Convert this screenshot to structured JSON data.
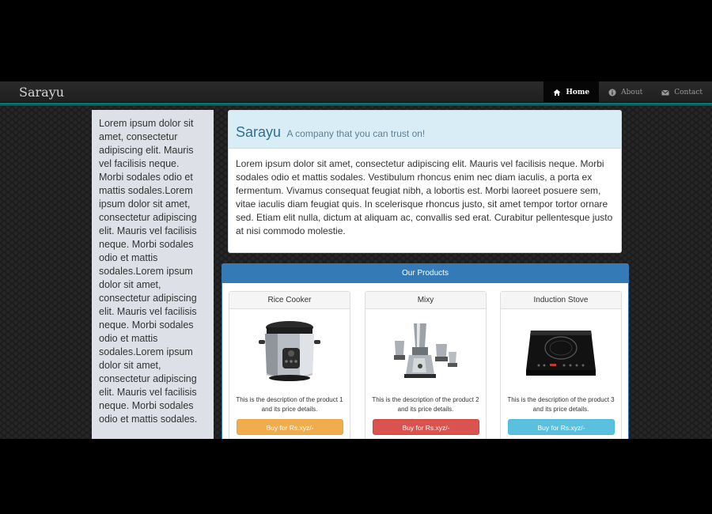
{
  "navbar": {
    "brand": "Sarayu",
    "items": [
      {
        "label": "Home",
        "icon": "home-icon",
        "active": true
      },
      {
        "label": "About",
        "icon": "info-icon",
        "active": false
      },
      {
        "label": "Contact",
        "icon": "envelope-icon",
        "active": false
      }
    ]
  },
  "sidebar": {
    "text": "Lorem ipsum dolor sit amet, consectetur adipiscing elit. Mauris vel facilisis neque. Morbi sodales odio et mattis sodales.Lorem ipsum dolor sit amet, consectetur adipiscing elit. Mauris vel facilisis neque. Morbi sodales odio et mattis sodales.Lorem ipsum dolor sit amet, consectetur adipiscing elit. Mauris vel facilisis neque. Morbi sodales odio et mattis sodales.Lorem ipsum dolor sit amet, consectetur adipiscing elit. Mauris vel facilisis neque. Morbi sodales odio et mattis sodales."
  },
  "hero": {
    "title": "Sarayu",
    "tagline": "A company that you can trust on!",
    "body": "Lorem ipsum dolor sit amet, consectetur adipiscing elit. Mauris vel facilisis neque. Morbi sodales odio et mattis sodales. Vestibulum rhoncus enim nec diam iaculis, a porta ex fermentum. Vivamus consequat feugiat nibh, a lobortis est. Morbi laoreet posuere sem, vitae iaculis diam feugiat quis. In scelerisque rhoncus justo, sit amet tempor tortor ornare sed. Etiam elit nulla, dictum at aliquam ac, convallis sed erat. Curabitur pellentesque justo at nisi commodo molestie."
  },
  "products": {
    "heading": "Our Products",
    "items": [
      {
        "name": "Rice Cooker",
        "description": "This is the description of the product 1 and its price details.",
        "button": "Buy for Rs.xyz/-",
        "button_color": "#f0ad4e",
        "image": "rice-cooker-image"
      },
      {
        "name": "Mixy",
        "description": "This is the description of the product 2 and its price details.",
        "button": "Buy for Rs.xyz/-",
        "button_color": "#d9534f",
        "image": "mixer-grinder-image"
      },
      {
        "name": "Induction Stove",
        "description": "This is the description of the product 3 and its price details.",
        "button": "Buy for Rs.xyz/-",
        "button_color": "#5bc0de",
        "image": "induction-stove-image"
      }
    ]
  },
  "colors": {
    "navbar_accent": "#0f7f7c",
    "panel_primary": "#337ab7",
    "hero_background": "#d9edf7",
    "hero_title": "#31708f",
    "sidebar_background": "#dde0e6"
  }
}
